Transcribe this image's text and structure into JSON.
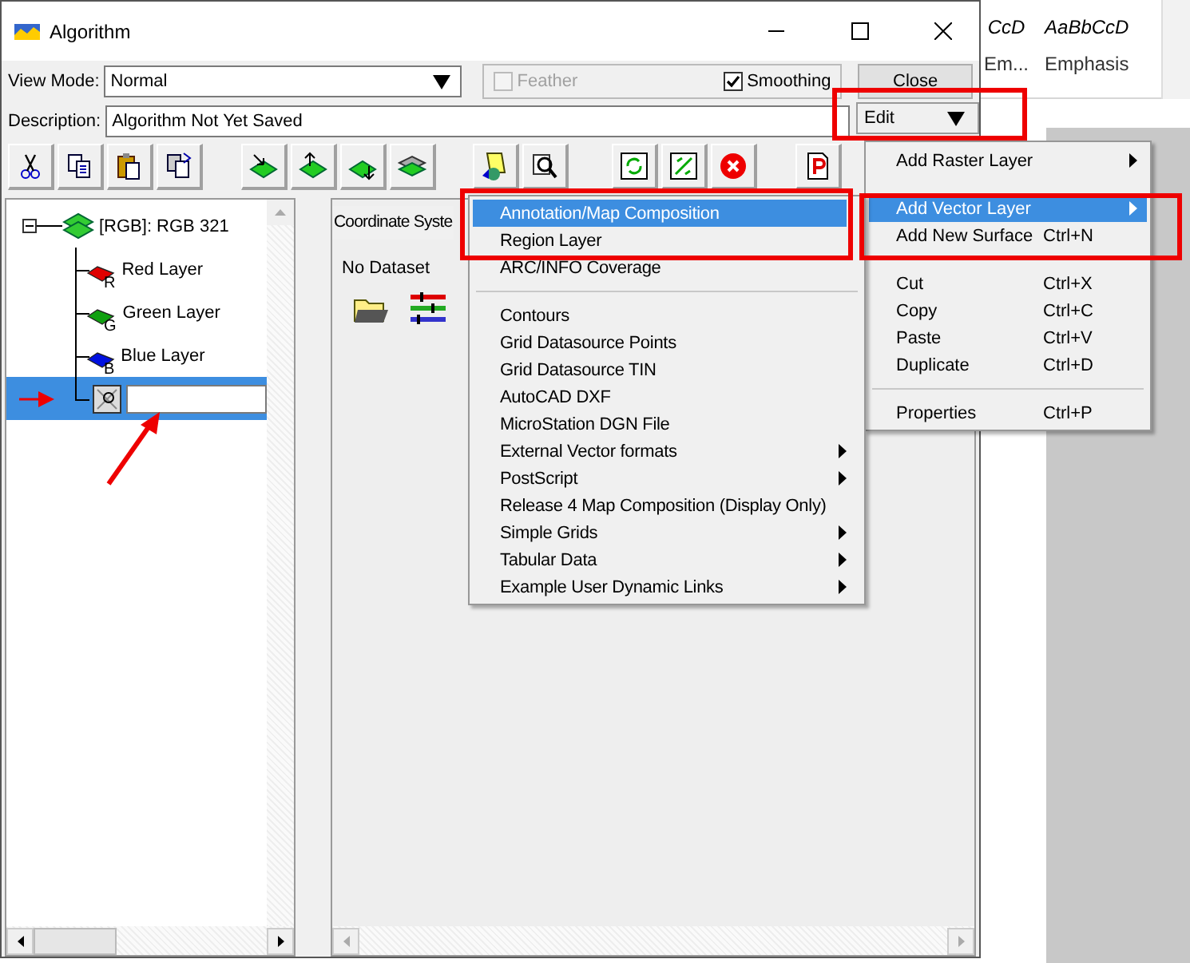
{
  "background_document": {
    "styles": [
      {
        "sample": "CcD",
        "name": "Em..."
      },
      {
        "sample": "AaBbCcD",
        "name": "Emphasis"
      }
    ]
  },
  "window": {
    "title": "Algorithm"
  },
  "view_mode": {
    "label": "View Mode:",
    "value": "Normal"
  },
  "options": [
    {
      "label": "Feather",
      "checked": false,
      "disabled": true
    },
    {
      "label": "Smoothing",
      "checked": true,
      "disabled": false
    }
  ],
  "close_button": "Close",
  "description": {
    "label": "Description:",
    "value": "Algorithm Not Yet Saved"
  },
  "edit_dropdown": {
    "value": "Edit"
  },
  "tree": {
    "label": "[RGB]: RGB 321",
    "expanded": true,
    "children": [
      {
        "kind": "layer",
        "label": "Red Layer",
        "badge": "R",
        "color": "#e00000",
        "selected": false
      },
      {
        "kind": "layer",
        "label": "Green Layer",
        "badge": "G",
        "color": "#10a010",
        "selected": false
      },
      {
        "kind": "layer",
        "label": "Blue Layer",
        "badge": "B",
        "color": "#0010e0",
        "selected": false
      },
      {
        "kind": "editor",
        "selected": true
      }
    ]
  },
  "right_panel": {
    "tab": "Coordinate Syste",
    "status": "No Dataset"
  },
  "edit_menu": [
    {
      "kind": "item",
      "label": "Add Raster Layer",
      "submenu": true,
      "selected": false
    },
    {
      "kind": "item",
      "label": "Add Vector Layer",
      "submenu": true,
      "selected": true
    },
    {
      "kind": "item",
      "label": "Add New Surface",
      "shortcut": "Ctrl+N",
      "submenu": false,
      "selected": false
    },
    {
      "kind": "separator"
    },
    {
      "kind": "item",
      "label": "Cut",
      "shortcut": "Ctrl+X",
      "submenu": false,
      "selected": false
    },
    {
      "kind": "item",
      "label": "Copy",
      "shortcut": "Ctrl+C",
      "submenu": false,
      "selected": false
    },
    {
      "kind": "item",
      "label": "Paste",
      "shortcut": "Ctrl+V",
      "submenu": false,
      "selected": false
    },
    {
      "kind": "item",
      "label": "Duplicate",
      "shortcut": "Ctrl+D",
      "submenu": false,
      "selected": false
    },
    {
      "kind": "separator"
    },
    {
      "kind": "item",
      "label": "Properties",
      "shortcut": "Ctrl+P",
      "submenu": false,
      "selected": false
    }
  ],
  "vector_submenu": [
    {
      "kind": "item",
      "label": "Annotation/Map Composition",
      "submenu": false,
      "selected": true
    },
    {
      "kind": "item",
      "label": "Region Layer",
      "submenu": false,
      "selected": false
    },
    {
      "kind": "item",
      "label": "ARC/INFO Coverage",
      "submenu": false,
      "selected": false
    },
    {
      "kind": "separator"
    },
    {
      "kind": "item",
      "label": "Contours",
      "submenu": false,
      "selected": false
    },
    {
      "kind": "item",
      "label": "Grid Datasource Points",
      "submenu": false,
      "selected": false
    },
    {
      "kind": "item",
      "label": "Grid Datasource TIN",
      "submenu": false,
      "selected": false
    },
    {
      "kind": "item",
      "label": "AutoCAD DXF",
      "submenu": false,
      "selected": false
    },
    {
      "kind": "item",
      "label": "MicroStation DGN File",
      "submenu": false,
      "selected": false
    },
    {
      "kind": "item",
      "label": "External Vector formats",
      "submenu": true,
      "selected": false
    },
    {
      "kind": "item",
      "label": "PostScript",
      "submenu": true,
      "selected": false
    },
    {
      "kind": "item",
      "label": "Release 4 Map Composition (Display Only)",
      "submenu": false,
      "selected": false
    },
    {
      "kind": "item",
      "label": "Simple Grids",
      "submenu": true,
      "selected": false
    },
    {
      "kind": "item",
      "label": "Tabular Data",
      "submenu": true,
      "selected": false
    },
    {
      "kind": "item",
      "label": "Example User Dynamic Links",
      "submenu": true,
      "selected": false
    }
  ]
}
